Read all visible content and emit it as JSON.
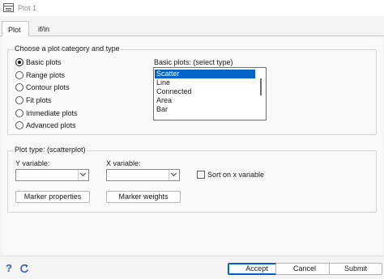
{
  "window": {
    "title": "Plot 1"
  },
  "tabs": [
    {
      "label": "Plot",
      "active": true
    },
    {
      "label": "if/in",
      "active": false
    }
  ],
  "plot_category": {
    "group_label": "Choose a plot category and type",
    "options": [
      {
        "label": "Basic plots",
        "checked": true
      },
      {
        "label": "Range plots",
        "checked": false
      },
      {
        "label": "Contour plots",
        "checked": false
      },
      {
        "label": "Fit plots",
        "checked": false
      },
      {
        "label": "Immediate plots",
        "checked": false
      },
      {
        "label": "Advanced plots",
        "checked": false
      }
    ],
    "list_label": "Basic plots: (select type)",
    "list_items": [
      {
        "label": "Scatter",
        "selected": true
      },
      {
        "label": "Line",
        "selected": false
      },
      {
        "label": "Connected",
        "selected": false
      },
      {
        "label": "Area",
        "selected": false
      },
      {
        "label": "Bar",
        "selected": false
      }
    ]
  },
  "plot_type": {
    "group_label": "Plot type: (scatterplot)",
    "y_variable": {
      "label": "Y variable:",
      "value": ""
    },
    "x_variable": {
      "label": "X variable:",
      "value": ""
    },
    "sort_checkbox": {
      "label": "Sort on x variable",
      "checked": false
    },
    "marker_properties_label": "Marker properties",
    "marker_weights_label": "Marker weights"
  },
  "footer": {
    "help_icon": "help-icon",
    "reset_icon": "refresh-icon",
    "accept_label": "Accept",
    "cancel_label": "Cancel",
    "submit_label": "Submit"
  },
  "colors": {
    "accent": "#0063c7",
    "help_icon": "#2f5fa6"
  }
}
